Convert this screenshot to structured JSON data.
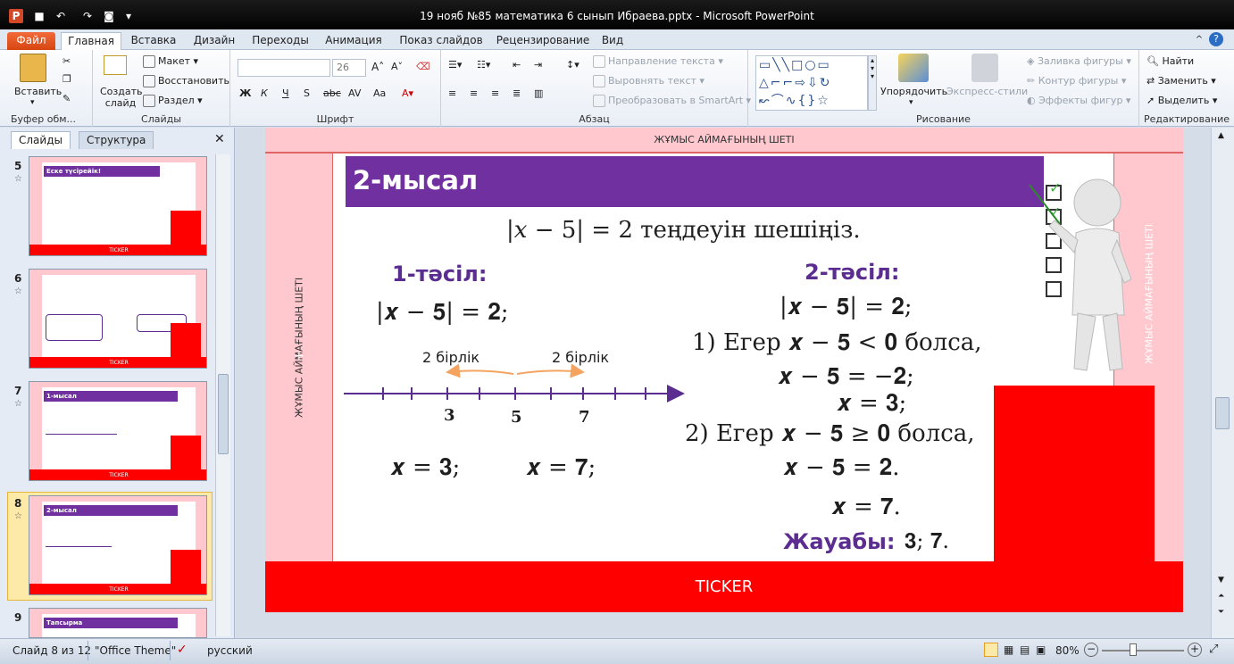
{
  "window": {
    "title": "19 нояб №85 математика 6 сынып Ибраева.pptx  -  Microsoft PowerPoint"
  },
  "tabs": [
    "Файл",
    "Главная",
    "Вставка",
    "Дизайн",
    "Переходы",
    "Анимация",
    "Показ слайдов",
    "Рецензирование",
    "Вид"
  ],
  "ribbon": {
    "paste": "Вставить",
    "clipboard_group": "Буфер обм...",
    "new_slide": "Создать слайд",
    "layout": "Макет",
    "reset": "Восстановить",
    "section": "Раздел",
    "slides_group": "Слайды",
    "font_size": "26",
    "font_group": "Шрифт",
    "text_direction": "Направление текста",
    "align_text": "Выровнять текст",
    "smartart": "Преобразовать в SmartArt",
    "paragraph_group": "Абзац",
    "arrange": "Упорядочить",
    "quick_styles": "Экспресс-стили",
    "shape_fill": "Заливка фигуры",
    "shape_outline": "Контур фигуры",
    "shape_effects": "Эффекты фигур",
    "drawing_group": "Рисование",
    "find": "Найти",
    "replace": "Заменить",
    "select": "Выделить",
    "editing_group": "Редактирование"
  },
  "left_pane": {
    "tab_slides": "Слайды",
    "tab_outline": "Структура",
    "thumbs": [
      {
        "num": "5",
        "title": "Еске түсірейік!"
      },
      {
        "num": "6",
        "title": ""
      },
      {
        "num": "7",
        "title": "1-мысал"
      },
      {
        "num": "8",
        "title": "2-мысал"
      },
      {
        "num": "9",
        "title": "Тапсырма"
      }
    ],
    "ticker": "TICKER"
  },
  "slide": {
    "top_label": "ЖҰМЫС АЙМАҒЫНЫҢ ШЕТІ",
    "left_label": "ЖҰМЫС АЙМАҒЫНЫҢ ШЕТІ",
    "right_label": "ЖҰМЫС АЙМАҒЫНЫҢ ШЕТІ",
    "title": "2-мысал",
    "task": "|𝑥 − 5| = 2 теңдеуін шешіңіз.",
    "m1_title": "1-тәсіл:",
    "m1_eq": "|𝒙 − 𝟓| = 𝟐;",
    "unit_left": "2 бірлік",
    "unit_right": "2 бірлік",
    "axis_3": "3",
    "axis_5": "5",
    "axis_7": "7",
    "m1_ans1": "𝒙 = 𝟑;",
    "m1_ans2": "𝒙 = 𝟕;",
    "m2_title": "2-тәсіл:",
    "m2_eq": "|𝒙 − 𝟓| = 𝟐;",
    "m2_l1": "1) Егер 𝒙 − 𝟓 < 𝟎 болса,",
    "m2_l2": "𝒙 − 𝟓 = −𝟐;",
    "m2_l3": "𝒙 = 𝟑;",
    "m2_l4": "2) Егер 𝒙 − 𝟓 ≥ 𝟎 болса,",
    "m2_l5": "𝒙 − 𝟓 = 𝟐.",
    "m2_l6": "𝒙 = 𝟕.",
    "answer_label": "Жауабы:",
    "answer_val": "𝟑; 𝟕.",
    "ticker": "TICKER"
  },
  "status": {
    "slide_pos": "Слайд 8 из 12",
    "theme": "\"Office Theme\"",
    "lang": "русский",
    "zoom": "80%"
  },
  "colors": {
    "purple": "#7030a0",
    "red": "#ff0000",
    "pink": "#ffc7ce"
  }
}
